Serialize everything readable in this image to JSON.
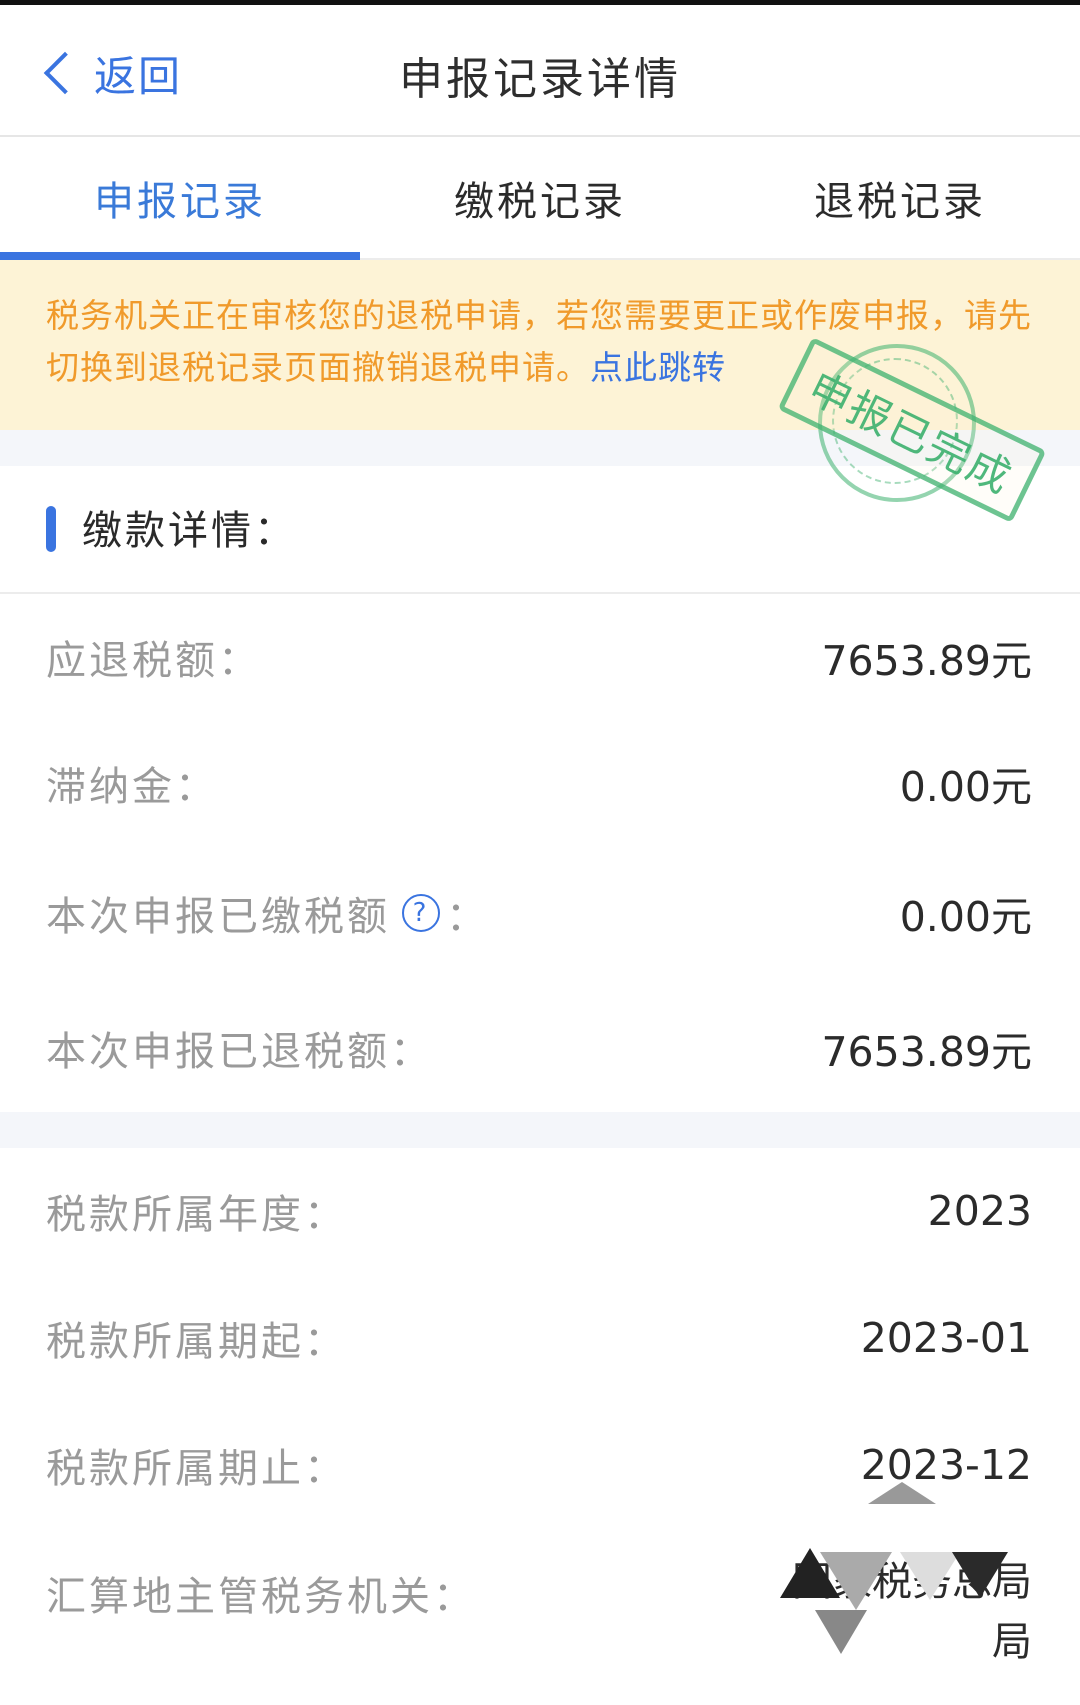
{
  "header": {
    "back_label": "返回",
    "title": "申报记录详情"
  },
  "tabs": [
    {
      "label": "申报记录",
      "active": true
    },
    {
      "label": "缴税记录",
      "active": false
    },
    {
      "label": "退税记录",
      "active": false
    }
  ],
  "notice": {
    "text": "税务机关正在审核您的退税申请，若您需要更正或作废申报，请先切换到退税记录页面撤销退税申请。",
    "link_label": "点此跳转"
  },
  "stamp": {
    "text": "申报已完成"
  },
  "section": {
    "title": "缴款详情："
  },
  "payment_rows": [
    {
      "label": "应退税额：",
      "value": "7653.89元"
    },
    {
      "label": "滞纳金：",
      "value": "0.00元"
    },
    {
      "label": "本次申报已缴税额",
      "label_suffix": "：",
      "value": "0.00元",
      "help_glyph": "?"
    },
    {
      "label": "本次申报已退税额：",
      "value": "7653.89元"
    }
  ],
  "period_rows": [
    {
      "label": "税款所属年度：",
      "value": "2023"
    },
    {
      "label": "税款所属期起：",
      "value": "2023-01"
    },
    {
      "label": "税款所属期止：",
      "value": "2023-12"
    }
  ],
  "authority": {
    "label": "汇算地主管税务机关：",
    "value_line1": "国家税务总局",
    "value_line2": "局"
  },
  "colors": {
    "accent": "#3a74e0",
    "notice_bg": "#fdf3d6",
    "notice_text": "#f09a2b",
    "stamp": "#3cb06e"
  }
}
